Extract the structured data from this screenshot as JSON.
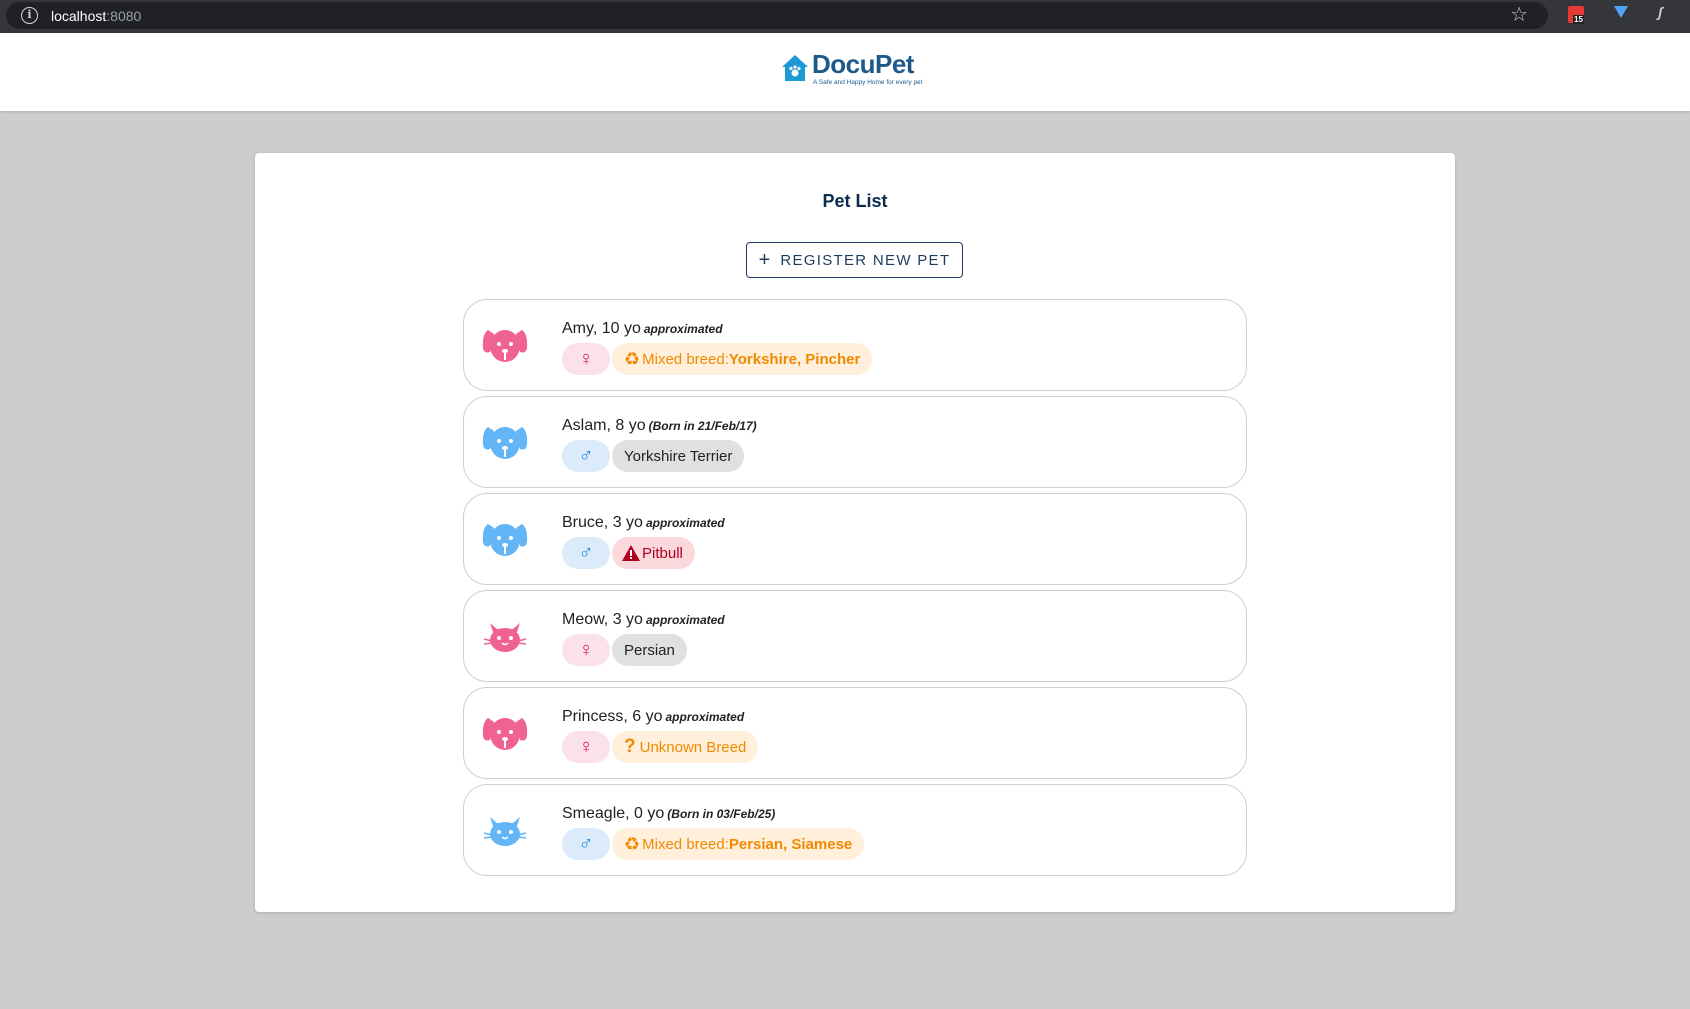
{
  "browser": {
    "url_host": "localhost",
    "url_port": ":8080",
    "calendar_badge": "15"
  },
  "header": {
    "logo_text": "DocuPet",
    "logo_tagline": "A Safe and Happy Home for every pet"
  },
  "page": {
    "title": "Pet List",
    "register_button": "REGISTER NEW PET"
  },
  "colors": {
    "female": "#f06292",
    "male": "#64b5f6",
    "brand": "#1c5a8c"
  },
  "pets": [
    {
      "name": "Amy, 10 yo",
      "note": "approximated",
      "species": "dog",
      "sex": "female",
      "sex_symbol": "♀",
      "breed_type": "mixed",
      "breed_label": "Mixed breed:",
      "breed_value": "Yorkshire, Pincher"
    },
    {
      "name": "Aslam, 8 yo",
      "note": "(Born in 21/Feb/17)",
      "species": "dog",
      "sex": "male",
      "sex_symbol": "♂",
      "breed_type": "normal",
      "breed_label": "Yorkshire Terrier",
      "breed_value": ""
    },
    {
      "name": "Bruce, 3 yo",
      "note": "approximated",
      "species": "dog",
      "sex": "male",
      "sex_symbol": "♂",
      "breed_type": "dangerous",
      "breed_label": "Pitbull",
      "breed_value": ""
    },
    {
      "name": "Meow, 3 yo",
      "note": "approximated",
      "species": "cat",
      "sex": "female",
      "sex_symbol": "♀",
      "breed_type": "normal",
      "breed_label": "Persian",
      "breed_value": ""
    },
    {
      "name": "Princess, 6 yo",
      "note": "approximated",
      "species": "dog",
      "sex": "female",
      "sex_symbol": "♀",
      "breed_type": "unknown",
      "breed_label": "Unknown Breed",
      "breed_value": ""
    },
    {
      "name": "Smeagle, 0 yo",
      "note": "(Born in 03/Feb/25)",
      "species": "cat",
      "sex": "male",
      "sex_symbol": "♂",
      "breed_type": "mixed",
      "breed_label": "Mixed breed:",
      "breed_value": "Persian, Siamese"
    }
  ]
}
